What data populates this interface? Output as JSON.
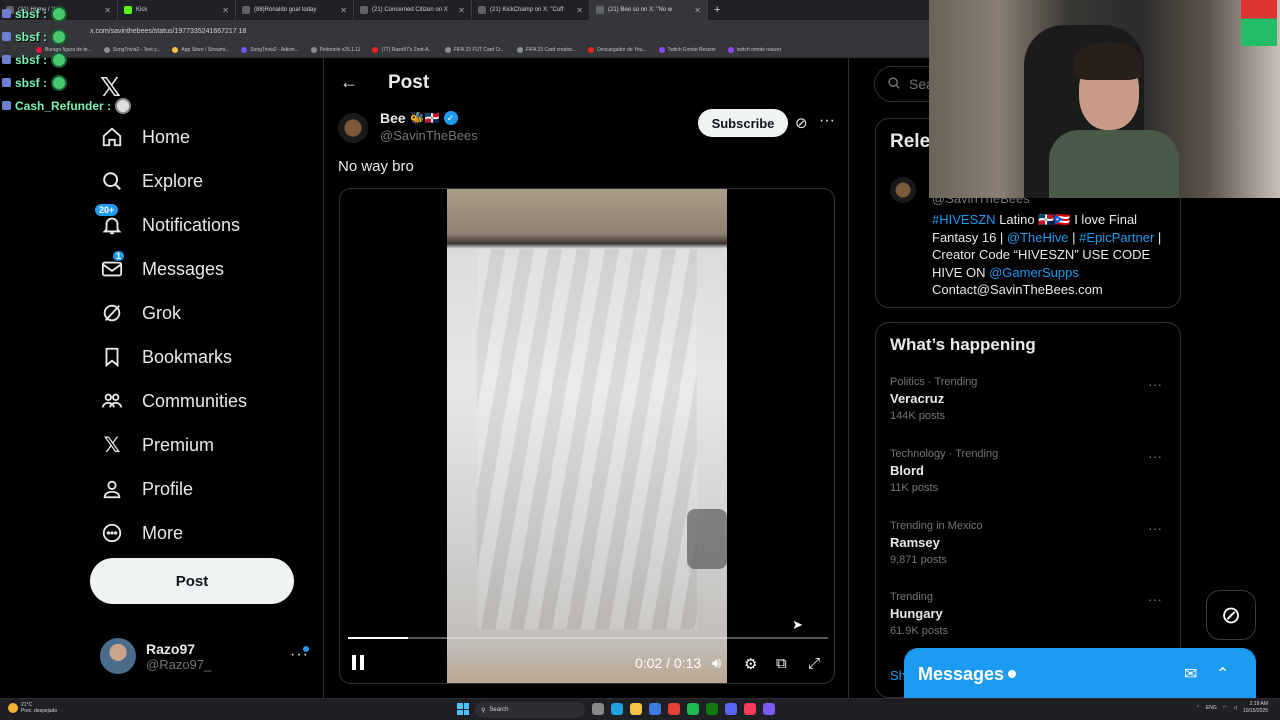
{
  "browser": {
    "tabs": [
      {
        "label": "(21) Home / X"
      },
      {
        "label": "Kick"
      },
      {
        "label": "(88)Ronaldo goal today"
      },
      {
        "label": "(21) Concerned Citizen on X"
      },
      {
        "label": "(21) KickChamp on X: \"Cuff"
      },
      {
        "label": "(21) Bee so on X: \"No w"
      }
    ],
    "url": "x.com/savinthebees/status/1977335241667217 18",
    "bookmarks": [
      "Burago figura de te...",
      "SongTrivia2 - Test y...",
      "App Store / Streami...",
      "SongTrivia2 - Adivin...",
      "Peletools v25.1.11",
      "(77) Razo97's Zest-A...",
      "FIFA 23 FUT Card Cr...",
      "FIFA 23 Card creator...",
      "Descargador de You...",
      "Twitch Emote Resizer",
      "twitch emote resizer"
    ]
  },
  "chat": [
    {
      "name": "sbsf :"
    },
    {
      "name": "sbsf :"
    },
    {
      "name": "sbsf :"
    },
    {
      "name": "sbsf :"
    },
    {
      "name": "Cash_Refunder :"
    }
  ],
  "nav": {
    "items": [
      {
        "label": "Home",
        "icon": "home-icon"
      },
      {
        "label": "Explore",
        "icon": "search-icon"
      },
      {
        "label": "Notifications",
        "icon": "bell-icon",
        "badge": "20+"
      },
      {
        "label": "Messages",
        "icon": "envelope-icon",
        "badge": "1"
      },
      {
        "label": "Grok",
        "icon": "grok-icon"
      },
      {
        "label": "Bookmarks",
        "icon": "bookmark-icon"
      },
      {
        "label": "Communities",
        "icon": "communities-icon"
      },
      {
        "label": "Premium",
        "icon": "x-icon"
      },
      {
        "label": "Profile",
        "icon": "profile-icon"
      },
      {
        "label": "More",
        "icon": "more-circle-icon"
      }
    ],
    "post_button": "Post",
    "profile": {
      "name": "Razo97",
      "handle": "@Razo97_"
    }
  },
  "main": {
    "title": "Post",
    "author": {
      "name": "Bee",
      "handle": "@SavinTheBees"
    },
    "subscribe_label": "Subscribe",
    "text": "No way bro",
    "video": {
      "time": "0:02 / 0:13",
      "progress": 0.125
    }
  },
  "right": {
    "search_placeholder": "Sear",
    "relevant_title": "Rele",
    "relevant_handle": "@SavinTheBees",
    "bio": {
      "p1": "#HIVESZN",
      "p2": " Latino 🇩🇴🇵🇷 I love Final Fantasy 16 | ",
      "p3": "@TheHive",
      "p4": " | ",
      "p5": "#EpicPartner",
      "p6": " | Creator Code “HIVESZN” USE CODE HIVE ON ",
      "p7": "@GamerSupps",
      "p8": " Contact@SavinTheBees.com"
    },
    "happening_title": "What’s happening",
    "trends": [
      {
        "category": "Politics · Trending",
        "name": "Veracruz",
        "count": "144K posts"
      },
      {
        "category": "Technology · Trending",
        "name": "Blord",
        "count": "11K posts"
      },
      {
        "category": "Trending in Mexico",
        "name": "Ramsey",
        "count": "9,871 posts"
      },
      {
        "category": "Trending",
        "name": "Hungary",
        "count": "61.9K posts"
      }
    ],
    "show_more": "Sh",
    "messages_drawer": "Messages"
  },
  "taskbar": {
    "weather_temp": "21°C",
    "weather_desc": "Prec. despejado",
    "search_label": "Search",
    "lang": "ENG",
    "time": "2:19 AM",
    "date": "10/15/2025"
  }
}
